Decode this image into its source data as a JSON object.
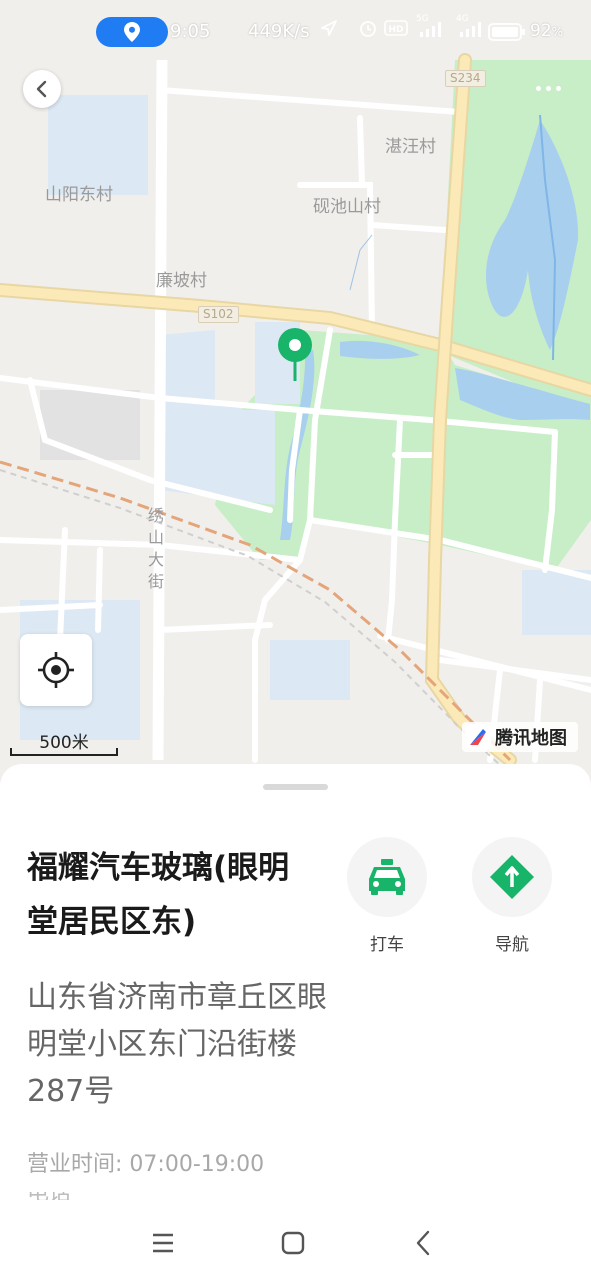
{
  "status_bar": {
    "time": "9:05",
    "speed": "449K/s",
    "network_1": "5G",
    "network_2": "4G",
    "battery": "92",
    "battery_unit": "%"
  },
  "map": {
    "place_labels": [
      "湛汪村",
      "山阳东村",
      "砚池山村",
      "廉坡村",
      "绣山大街"
    ],
    "road_shields": [
      "S234",
      "S102"
    ],
    "scale_text": "500米",
    "brand": "腾讯地图",
    "colors": {
      "base": "#f1efec",
      "green": "#c7eec7",
      "water": "#a9cfee",
      "major_road": "#fbeab7",
      "pin": "#18b46a"
    }
  },
  "poi": {
    "title": "福耀汽车玻璃(眼明堂居民区东)",
    "address": "山东省济南市章丘区眼明堂小区东门沿街楼287号",
    "hours_label": "营业时间:",
    "hours_value": "07:00-19:00",
    "phone_label": "电话"
  },
  "actions": {
    "taxi_label": "打车",
    "navigate_label": "导航",
    "taxi_color": "#18b46a",
    "navigate_color": "#18b46a"
  },
  "icons": {
    "back": "chevron-left-icon",
    "more": "more-dots-icon",
    "locate": "locate-target-icon",
    "taxi": "taxi-icon",
    "navigate": "navigate-turn-icon",
    "nav_menu": "menu-icon",
    "nav_home": "home-square-icon",
    "nav_back": "back-chevron-icon"
  }
}
